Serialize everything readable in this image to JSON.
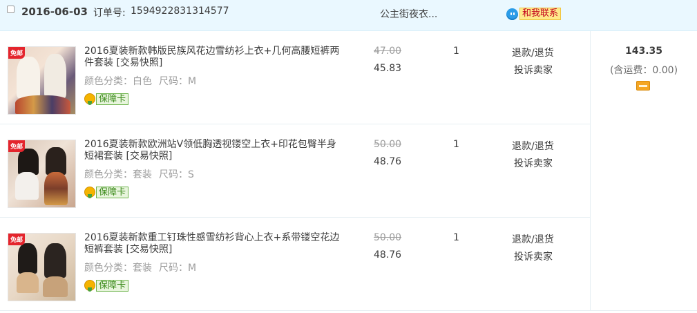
{
  "order": {
    "date": "2016-06-03",
    "number_label": "订单号:",
    "number": "1594922831314577",
    "shop_name": "公主街夜衣...",
    "contact_label": "和我联系",
    "total": "143.35",
    "shipping_note": "(含运费：0.00)"
  },
  "items": [
    {
      "title": "2016夏装新款韩版民族风花边雪纺衫上衣+几何高腰短裤两件套装 [交易快照]",
      "sku_color_label": "颜色分类：白色",
      "sku_size_label": "尺码：M",
      "guarantee_label": "保障卡",
      "original_price": "47.00",
      "price": "45.83",
      "quantity": "1",
      "refund_label": "退款/退货",
      "complain_label": "投诉卖家",
      "thumb_badge": "免邮"
    },
    {
      "title": "2016夏装新款欧洲站V领低胸透视镂空上衣+印花包臀半身短裙套装 [交易快照]",
      "sku_color_label": "颜色分类：套装",
      "sku_size_label": "尺码：S",
      "guarantee_label": "保障卡",
      "original_price": "50.00",
      "price": "48.76",
      "quantity": "1",
      "refund_label": "退款/退货",
      "complain_label": "投诉卖家",
      "thumb_badge": "免邮"
    },
    {
      "title": "2016夏装新款重工钉珠性感雪纺衫背心上衣+系带镂空花边短裤套装 [交易快照]",
      "sku_color_label": "颜色分类：套装",
      "sku_size_label": "尺码：M",
      "guarantee_label": "保障卡",
      "original_price": "50.00",
      "price": "48.76",
      "quantity": "1",
      "refund_label": "退款/退货",
      "complain_label": "投诉卖家",
      "thumb_badge": "免邮"
    }
  ],
  "colors": {
    "header_bg": "#eaf8ff",
    "contact_red": "#c2001d",
    "guarantee_green": "#3c8b1c"
  },
  "icons": {
    "checkbox": "checkbox-icon",
    "wangwang": "wangwang-chat-icon",
    "guarantee": "guarantee-badge-icon",
    "payment_card": "payment-card-icon"
  }
}
